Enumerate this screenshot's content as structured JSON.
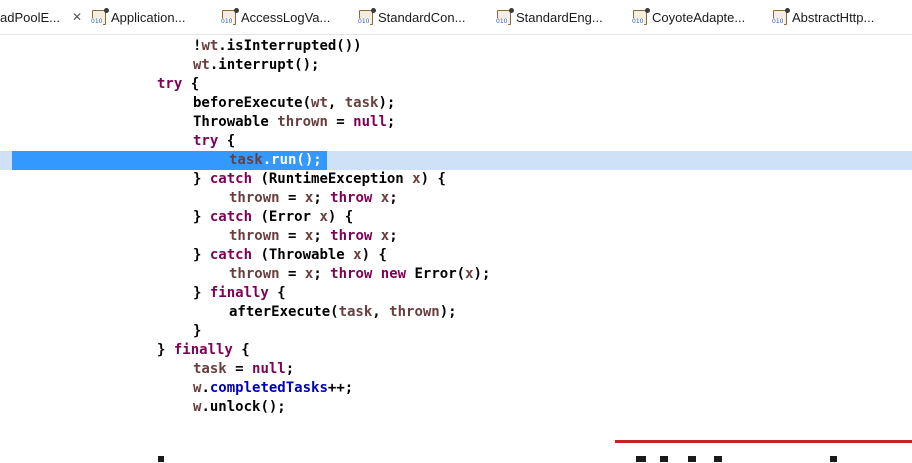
{
  "tabs": [
    {
      "label": "adPoolE...",
      "active": true,
      "close": "✕"
    },
    {
      "label": "Application..."
    },
    {
      "label": "AccessLogVa..."
    },
    {
      "label": "StandardCon..."
    },
    {
      "label": "StandardEng..."
    },
    {
      "label": "CoyoteAdapte..."
    },
    {
      "label": "AbstractHttp..."
    }
  ],
  "file_icon_text": "010",
  "code_lines": [
    {
      "tokens": [
        [
          "p",
          "!"
        ],
        [
          "var",
          "wt"
        ],
        [
          "p",
          ".isInterrupted())"
        ]
      ]
    },
    {
      "tokens": [
        [
          "var",
          "wt"
        ],
        [
          "p",
          ".interrupt();"
        ]
      ]
    },
    {
      "tokens": [
        [
          "kw",
          "try"
        ],
        [
          "p",
          " {"
        ]
      ]
    },
    {
      "tokens": [
        [
          "p",
          "beforeExecute("
        ],
        [
          "var",
          "wt"
        ],
        [
          "p",
          ", "
        ],
        [
          "var",
          "task"
        ],
        [
          "p",
          ");"
        ]
      ]
    },
    {
      "tokens": [
        [
          "p",
          "Throwable "
        ],
        [
          "var",
          "thrown"
        ],
        [
          "p",
          " = "
        ],
        [
          "kw",
          "null"
        ],
        [
          "p",
          ";"
        ]
      ]
    },
    {
      "tokens": [
        [
          "kw",
          "try"
        ],
        [
          "p",
          " {"
        ]
      ]
    },
    {
      "tokens": [
        [
          "var",
          "task"
        ],
        [
          "p",
          ".run();"
        ]
      ]
    },
    {
      "tokens": [
        [
          "p",
          "} "
        ],
        [
          "kw",
          "catch"
        ],
        [
          "p",
          " (RuntimeException "
        ],
        [
          "var",
          "x"
        ],
        [
          "p",
          ") {"
        ]
      ]
    },
    {
      "tokens": [
        [
          "var",
          "thrown"
        ],
        [
          "p",
          " = "
        ],
        [
          "var",
          "x"
        ],
        [
          "p",
          "; "
        ],
        [
          "kw",
          "throw"
        ],
        [
          "p",
          " "
        ],
        [
          "var",
          "x"
        ],
        [
          "p",
          ";"
        ]
      ]
    },
    {
      "tokens": [
        [
          "p",
          "} "
        ],
        [
          "kw",
          "catch"
        ],
        [
          "p",
          " (Error "
        ],
        [
          "var",
          "x"
        ],
        [
          "p",
          ") {"
        ]
      ]
    },
    {
      "tokens": [
        [
          "var",
          "thrown"
        ],
        [
          "p",
          " = "
        ],
        [
          "var",
          "x"
        ],
        [
          "p",
          "; "
        ],
        [
          "kw",
          "throw"
        ],
        [
          "p",
          " "
        ],
        [
          "var",
          "x"
        ],
        [
          "p",
          ";"
        ]
      ]
    },
    {
      "tokens": [
        [
          "p",
          "} "
        ],
        [
          "kw",
          "catch"
        ],
        [
          "p",
          " (Throwable "
        ],
        [
          "var",
          "x"
        ],
        [
          "p",
          ") {"
        ]
      ]
    },
    {
      "tokens": [
        [
          "var",
          "thrown"
        ],
        [
          "p",
          " = "
        ],
        [
          "var",
          "x"
        ],
        [
          "p",
          "; "
        ],
        [
          "kw",
          "throw"
        ],
        [
          "p",
          " "
        ],
        [
          "kw",
          "new"
        ],
        [
          "p",
          " Error("
        ],
        [
          "var",
          "x"
        ],
        [
          "p",
          ");"
        ]
      ]
    },
    {
      "tokens": [
        [
          "p",
          "} "
        ],
        [
          "kw",
          "finally"
        ],
        [
          "p",
          " {"
        ]
      ]
    },
    {
      "tokens": [
        [
          "p",
          "afterExecute("
        ],
        [
          "var",
          "task"
        ],
        [
          "p",
          ", "
        ],
        [
          "var",
          "thrown"
        ],
        [
          "p",
          ");"
        ]
      ]
    },
    {
      "tokens": [
        [
          "p",
          "}"
        ]
      ]
    },
    {
      "tokens": [
        [
          "p",
          "} "
        ],
        [
          "kw",
          "finally"
        ],
        [
          "p",
          " {"
        ]
      ]
    },
    {
      "tokens": [
        [
          "var",
          "task"
        ],
        [
          "p",
          " = "
        ],
        [
          "kw",
          "null"
        ],
        [
          "p",
          ";"
        ]
      ]
    },
    {
      "tokens": [
        [
          "var",
          "w"
        ],
        [
          "p",
          "."
        ],
        [
          "fld",
          "completedTasks"
        ],
        [
          "p",
          "++;"
        ]
      ]
    },
    {
      "tokens": [
        [
          "var",
          "w"
        ],
        [
          "p",
          ".unlock();"
        ]
      ]
    }
  ],
  "colors": {
    "keyword": "#7f0055",
    "local_variable": "#6a3e3e",
    "field": "#0000c0",
    "selection": "#3399ff",
    "current_line": "#cfe1f6",
    "error_line": "#c9211e"
  }
}
